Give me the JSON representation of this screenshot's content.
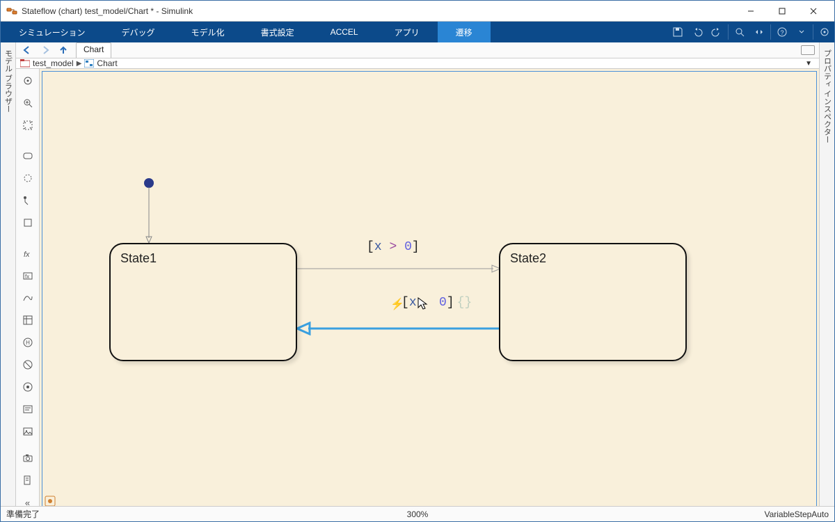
{
  "window": {
    "title": "Stateflow (chart) test_model/Chart * - Simulink"
  },
  "menu": {
    "items": [
      "シミュレーション",
      "デバッグ",
      "モデル化",
      "書式設定",
      "ACCEL",
      "アプリ",
      "遷移"
    ],
    "active_index": 6
  },
  "side_tabs": {
    "left": "モデル ブラウザー",
    "right": "プロパティ インスペクター"
  },
  "nav": {
    "tab": "Chart"
  },
  "breadcrumb": {
    "model": "test_model",
    "chart": "Chart"
  },
  "chart_data": {
    "type": "state-diagram",
    "states": [
      {
        "name": "State1"
      },
      {
        "name": "State2"
      }
    ],
    "transitions": [
      {
        "from": "__initial__",
        "to": "State1",
        "label": ""
      },
      {
        "from": "State1",
        "to": "State2",
        "condition": "[x > 0]"
      },
      {
        "from": "State2",
        "to": "State1",
        "condition": "[x < 0]",
        "selected": true
      }
    ]
  },
  "labels": {
    "t1_bracket_open": "[",
    "t1_var": "x",
    "t1_op": ">",
    "t1_num": "0",
    "t1_bracket_close": "]",
    "t2_bracket_open": "[",
    "t2_var": "x",
    "t2_op": "<",
    "t2_num": "0",
    "t2_bracket_close": "]",
    "t2_curly": "{}"
  },
  "status": {
    "left": "準備完了",
    "center": "300%",
    "right": "VariableStepAuto"
  }
}
